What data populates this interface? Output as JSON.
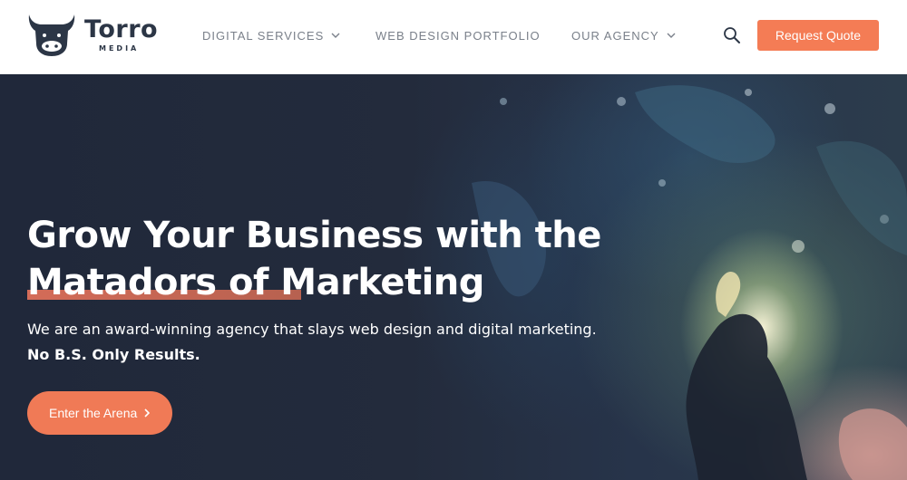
{
  "brand": {
    "name": "Torro",
    "tagline": "MEDIA",
    "logo_icon": "bull-head-icon",
    "accent": "#f47c55",
    "dark": "#2c3646"
  },
  "nav": {
    "items": [
      {
        "label": "DIGITAL SERVICES",
        "has_dropdown": true
      },
      {
        "label": "WEB DESIGN PORTFOLIO",
        "has_dropdown": false
      },
      {
        "label": "OUR AGENCY",
        "has_dropdown": true
      }
    ],
    "search_icon": "search-icon",
    "cta_label": "Request Quote"
  },
  "hero": {
    "title_line1": "Grow Your Business with the",
    "title_line2": "Matadors of Marketing",
    "subtitle": "We are an award-winning agency that slays web design and digital marketing.",
    "subtitle_bold": "No B.S. Only Results.",
    "cta_label": "Enter the Arena",
    "cta_icon": "chevron-right-icon"
  }
}
